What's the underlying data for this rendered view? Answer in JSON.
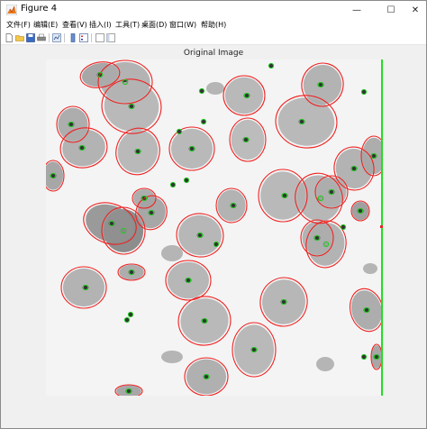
{
  "window": {
    "title": "Figure 4",
    "minimize_symbol": "—",
    "maximize_symbol": "☐",
    "close_symbol": "✕"
  },
  "menu": [
    "文件(F)",
    "编辑(E)",
    "查看(V)",
    "插入(I)",
    "工具(T)",
    "桌面(D)",
    "窗口(W)",
    "帮助(H)"
  ],
  "toolbar_icons": [
    "new-figure-icon",
    "open-file-icon",
    "save-icon",
    "print-icon",
    "link-plot-icon",
    "insert-colorbar-icon",
    "insert-legend-icon",
    "hide-plot-tools-icon",
    "show-plot-tools-icon"
  ],
  "axes": {
    "title": "Original Image"
  },
  "colors": {
    "cell_outline": "#ee2222",
    "nucleus_marker": "#22cc22",
    "boundary_line": "#22dd22",
    "cell_fill": "#c8c8c8",
    "background": "#f4f4f4"
  }
}
